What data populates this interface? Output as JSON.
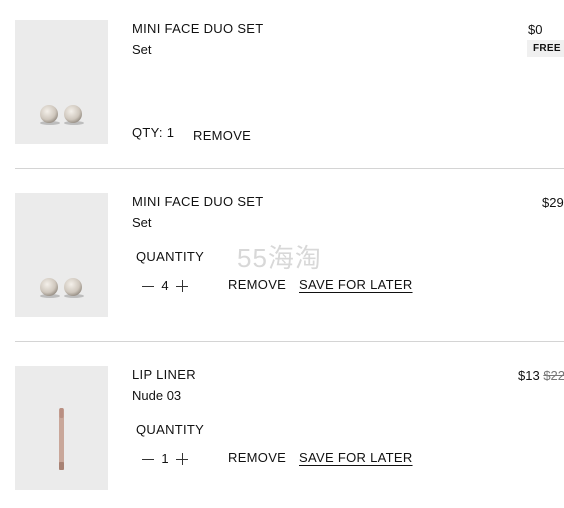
{
  "items": [
    {
      "name": "MINI FACE DUO SET",
      "variant": "Set",
      "qty_label": "QTY: 1",
      "remove_label": "REMOVE",
      "price": "$0",
      "badge": "FREE"
    },
    {
      "name": "MINI FACE DUO SET",
      "variant": "Set",
      "quantity_label": "QUANTITY",
      "quantity": "4",
      "remove_label": "REMOVE",
      "save_label": "SAVE FOR LATER",
      "price": "$29"
    },
    {
      "name": "LIP LINER",
      "variant": "Nude 03",
      "quantity_label": "QUANTITY",
      "quantity": "1",
      "remove_label": "REMOVE",
      "save_label": "SAVE FOR LATER",
      "price": "$13",
      "original_price": "$22"
    }
  ],
  "watermark": "55海淘",
  "colors": {
    "thumb_bg": "#ebebeb",
    "divider": "#d4d4d4"
  },
  "icons": [
    "minus-icon",
    "plus-icon"
  ]
}
